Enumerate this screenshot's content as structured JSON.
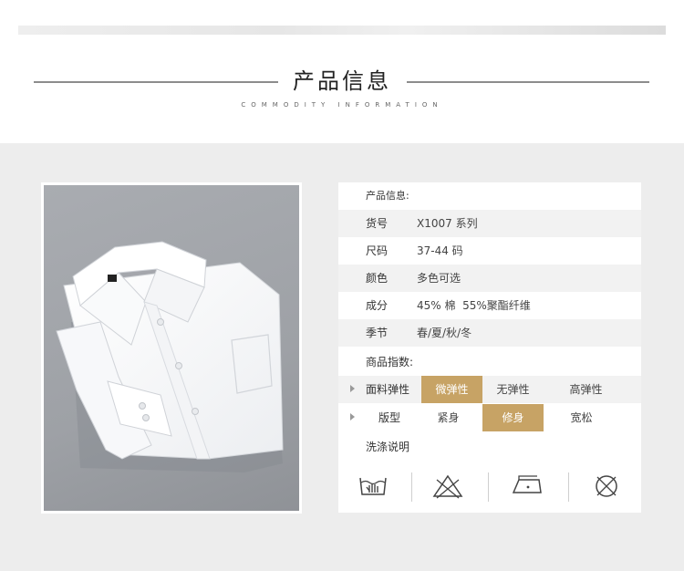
{
  "header": {
    "title": "产品信息",
    "subtitle": "COMMODITY INFORMATION"
  },
  "info": {
    "heading": "产品信息:",
    "rows": [
      {
        "label": "货号",
        "value": "X1007 系列"
      },
      {
        "label": "尺码",
        "value": "37-44 码"
      },
      {
        "label": "颜色",
        "value": "多色可选"
      },
      {
        "label": "成分",
        "value": "45% 棉  55%聚酯纤维"
      },
      {
        "label": "季节",
        "value": "春/夏/秋/冬"
      }
    ],
    "index_heading": "商品指数:",
    "elasticity": {
      "label": "面料弹性",
      "options": [
        "微弹性",
        "无弹性",
        "高弹性"
      ],
      "selected": "微弹性"
    },
    "fit": {
      "label": "版型",
      "options": [
        "紧身",
        "修身",
        "宽松"
      ],
      "selected": "修身"
    },
    "care_heading": "洗涤说明",
    "care_icons": [
      "hand-wash-icon",
      "no-bleach-icon",
      "iron-icon",
      "no-dry-clean-icon"
    ]
  },
  "colors": {
    "accent": "#c7a365",
    "panel": "#ededed",
    "row_alt": "#f2f2f2"
  }
}
